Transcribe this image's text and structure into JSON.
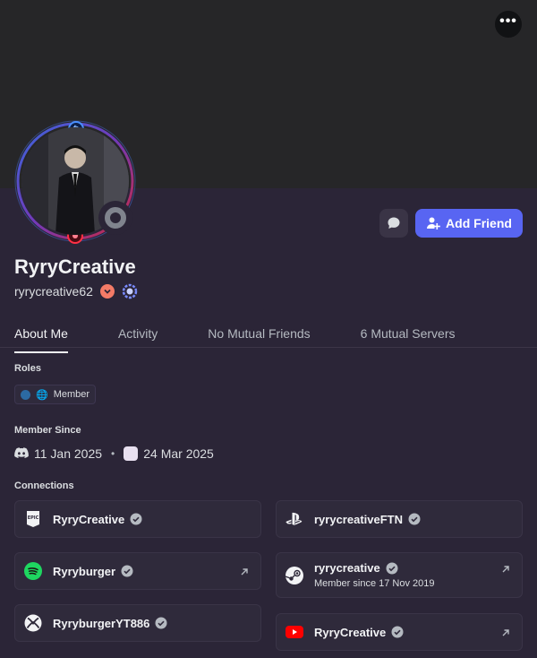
{
  "profile": {
    "display_name": "RyryCreative",
    "username": "ryrycreative62",
    "status": "offline"
  },
  "actions": {
    "more_label": "•••",
    "add_friend_label": "Add Friend"
  },
  "tabs": [
    {
      "label": "About Me",
      "active": true
    },
    {
      "label": "Activity",
      "active": false
    },
    {
      "label": "No Mutual Friends",
      "active": false
    },
    {
      "label": "6 Mutual Servers",
      "active": false
    }
  ],
  "sections": {
    "roles_title": "Roles",
    "member_since_title": "Member Since",
    "connections_title": "Connections"
  },
  "roles": [
    {
      "label": "Member",
      "color": "#2c6aa3"
    }
  ],
  "member_since": {
    "discord": "11 Jan 2025",
    "server": "24 Mar 2025"
  },
  "connections": [
    {
      "service": "epic-games",
      "name": "RyryCreative",
      "verified": true,
      "external": false
    },
    {
      "service": "playstation",
      "name": "ryrycreativeFTN",
      "verified": true,
      "external": false
    },
    {
      "service": "spotify",
      "name": "Ryryburger",
      "verified": true,
      "external": true
    },
    {
      "service": "steam",
      "name": "ryrycreative",
      "verified": true,
      "external": true,
      "sub": "Member since 17 Nov 2019"
    },
    {
      "service": "xbox",
      "name": "RyryburgerYT886",
      "verified": true,
      "external": false
    },
    {
      "service": "youtube",
      "name": "RyryCreative",
      "verified": true,
      "external": true
    }
  ],
  "colors": {
    "accent": "#5865f2",
    "background": "#2b2537",
    "banner": "#262628"
  }
}
